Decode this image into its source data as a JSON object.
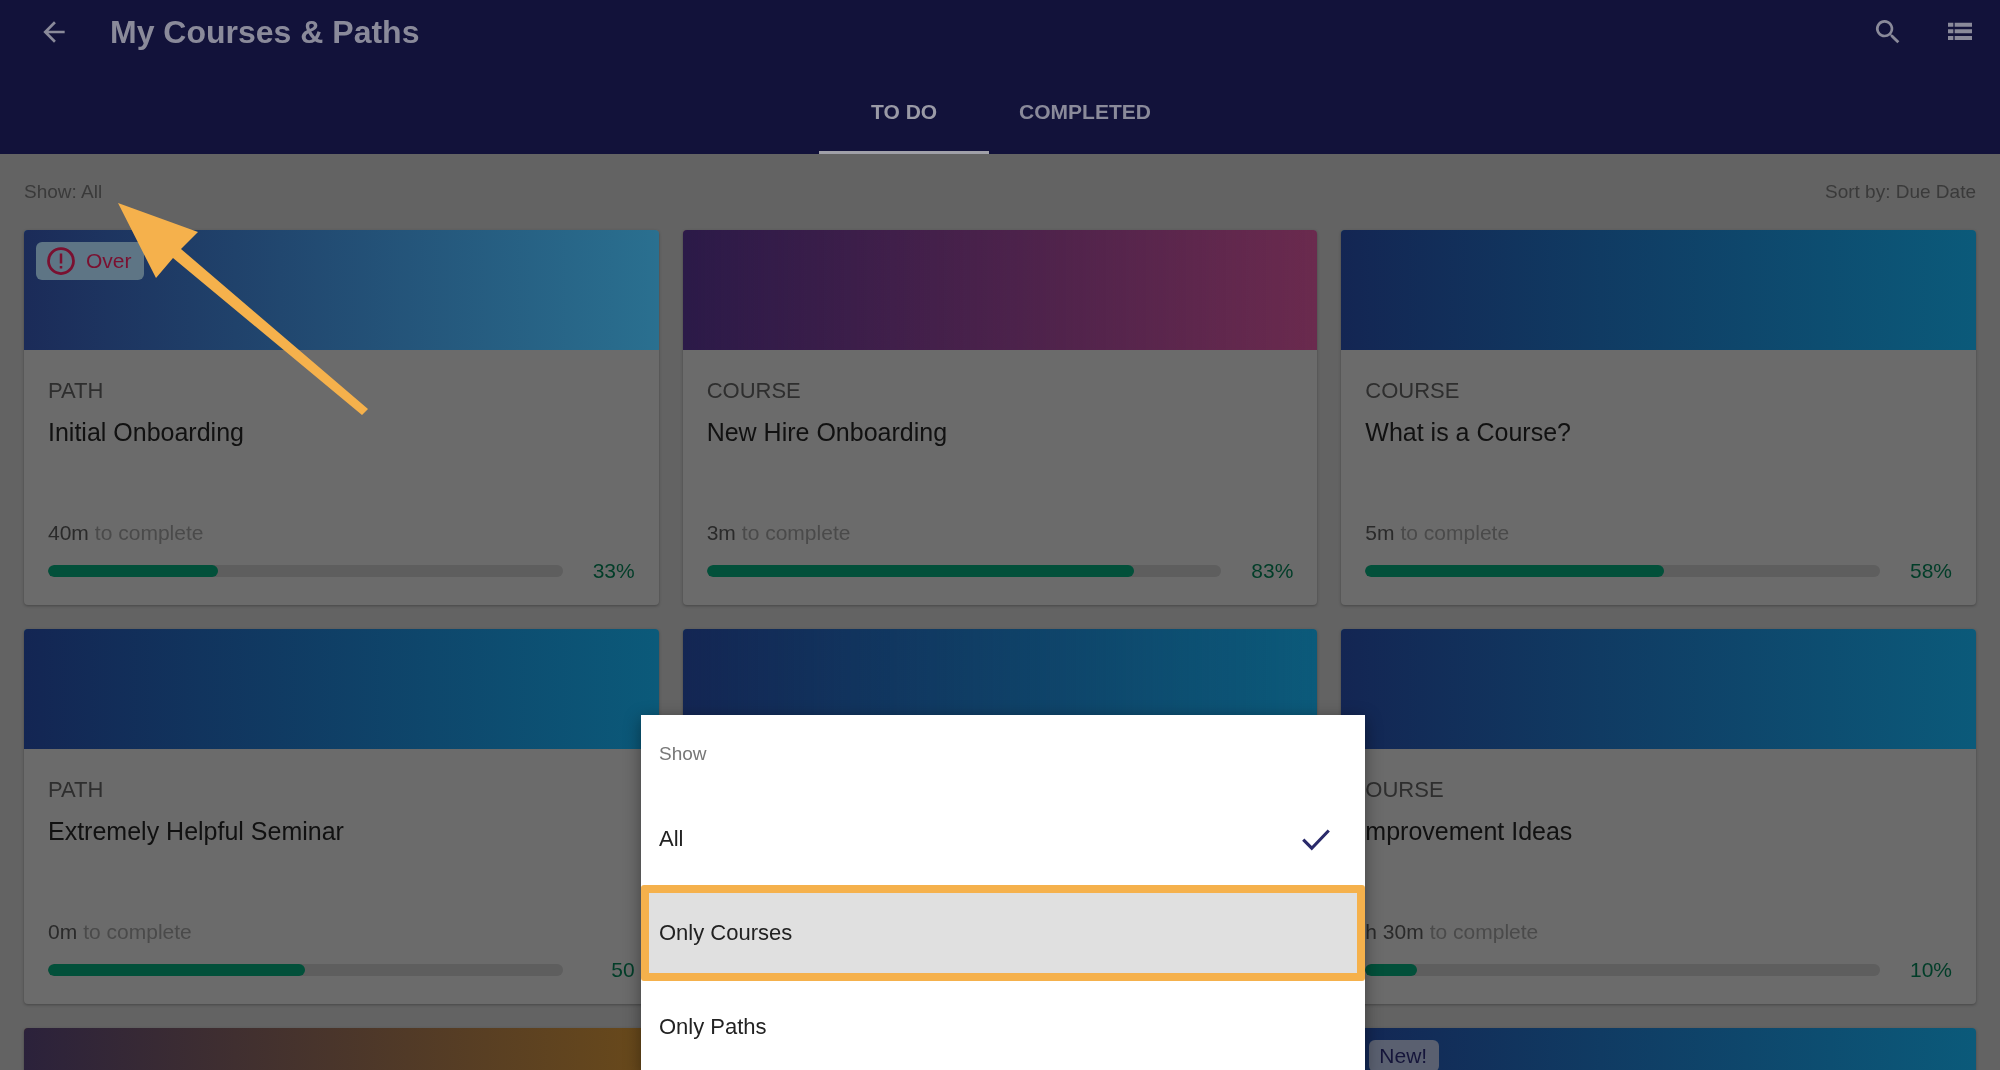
{
  "app_bar": {
    "title": "My Courses & Paths"
  },
  "tabs": [
    {
      "label": "TO DO",
      "selected": true
    },
    {
      "label": "COMPLETED",
      "selected": false
    }
  ],
  "filter_bar": {
    "show": "Show: All",
    "sort": "Sort by: Due Date"
  },
  "columns": [
    {
      "cards": [
        {
          "color": "#2a7090",
          "badge": {
            "kind": "overdue",
            "label": "Over"
          },
          "type": "PATH",
          "title": "Initial Onboarding",
          "duration": "40m",
          "duration_note": "to complete",
          "level": 0.33,
          "percent": "33%"
        },
        {
          "color": "#0b5a7a",
          "type": "PATH",
          "title": "Extremely Helpful Seminar",
          "duration": "0m",
          "duration_note": "to complete",
          "level": 0.5,
          "percent": "50"
        },
        {
          "color": "#6a4a1a"
        }
      ]
    },
    {
      "cards": [
        {
          "color": "#6a2a4e",
          "type": "COURSE",
          "title": "New Hire Onboarding",
          "duration": "3m",
          "duration_note": "to complete",
          "level": 0.83,
          "percent": "83%"
        },
        {
          "color": "#0b5a7a"
        }
      ]
    },
    {
      "cards": [
        {
          "color": "#0b5a7a",
          "type": "COURSE",
          "title": "What is a Course?",
          "duration": "5m",
          "duration_note": "to complete",
          "level": 0.58,
          "percent": "58%"
        },
        {
          "color": "#0b5a7a",
          "type": "OURSE",
          "title": "mprovement Ideas",
          "duration": "h 30m",
          "duration_note": "to complete",
          "level": 0.1,
          "percent": "10%"
        },
        {
          "color": "#0b5a7a",
          "badge": {
            "kind": "new",
            "label": "New!"
          }
        }
      ]
    }
  ],
  "menu": {
    "title": "Show",
    "options": [
      {
        "label": "All",
        "selected": true,
        "highlighted": false
      },
      {
        "label": "Only Courses",
        "selected": false,
        "highlighted": true
      },
      {
        "label": "Only Paths",
        "selected": false,
        "highlighted": false
      }
    ]
  }
}
